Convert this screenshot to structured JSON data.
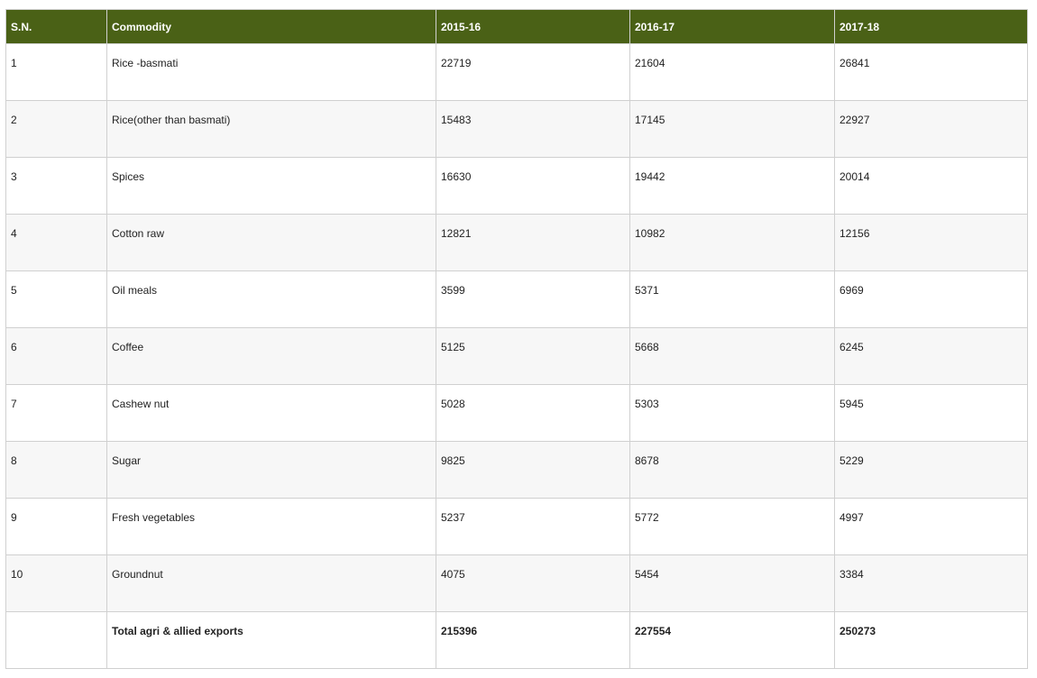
{
  "colors": {
    "header_bg": "#4a6116",
    "header_text": "#ffffff",
    "row_alt_bg": "#f7f7f7",
    "border": "#d0d0d0"
  },
  "table": {
    "headers": [
      "S.N.",
      "Commodity",
      "2015-16",
      "2016-17",
      "2017-18"
    ],
    "rows": [
      {
        "sn": "1",
        "commodity": "Rice -basmati",
        "y2015_16": "22719",
        "y2016_17": "21604",
        "y2017_18": "26841"
      },
      {
        "sn": "2",
        "commodity": "Rice(other than basmati)",
        "y2015_16": "15483",
        "y2016_17": "17145",
        "y2017_18": "22927"
      },
      {
        "sn": "3",
        "commodity": "Spices",
        "y2015_16": "16630",
        "y2016_17": "19442",
        "y2017_18": "20014"
      },
      {
        "sn": "4",
        "commodity": "Cotton raw",
        "y2015_16": "12821",
        "y2016_17": "10982",
        "y2017_18": "12156"
      },
      {
        "sn": "5",
        "commodity": "Oil meals",
        "y2015_16": "3599",
        "y2016_17": "5371",
        "y2017_18": "6969"
      },
      {
        "sn": "6",
        "commodity": "Coffee",
        "y2015_16": "5125",
        "y2016_17": "5668",
        "y2017_18": "6245"
      },
      {
        "sn": "7",
        "commodity": "Cashew nut",
        "y2015_16": "5028",
        "y2016_17": "5303",
        "y2017_18": "5945"
      },
      {
        "sn": "8",
        "commodity": "Sugar",
        "y2015_16": "9825",
        "y2016_17": "8678",
        "y2017_18": "5229"
      },
      {
        "sn": "9",
        "commodity": "Fresh vegetables",
        "y2015_16": "5237",
        "y2016_17": "5772",
        "y2017_18": "4997"
      },
      {
        "sn": "10",
        "commodity": "Groundnut",
        "y2015_16": "4075",
        "y2016_17": "5454",
        "y2017_18": "3384"
      }
    ],
    "total": {
      "sn": "",
      "commodity": "Total agri & allied exports",
      "y2015_16": "215396",
      "y2016_17": "227554",
      "y2017_18": "250273"
    }
  }
}
